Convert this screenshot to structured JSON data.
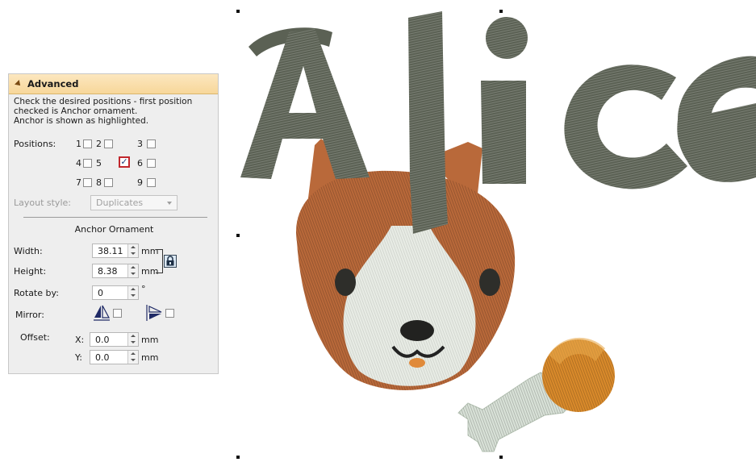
{
  "panel": {
    "header": "Advanced",
    "description": {
      "line1": "Check the desired positions - first position",
      "line2": "checked is Anchor ornament.",
      "line3": "Anchor is shown as highlighted."
    },
    "positions_label": "Positions:",
    "positions": [
      {
        "n": "1",
        "checked": false
      },
      {
        "n": "2",
        "checked": false
      },
      {
        "n": "3",
        "checked": false
      },
      {
        "n": "4",
        "checked": false
      },
      {
        "n": "5",
        "checked": true
      },
      {
        "n": "6",
        "checked": false
      },
      {
        "n": "7",
        "checked": false
      },
      {
        "n": "8",
        "checked": false
      },
      {
        "n": "9",
        "checked": false
      }
    ],
    "layout_style_label": "Layout style:",
    "layout_style_value": "Duplicates",
    "section_title": "Anchor Ornament",
    "width_label": "Width:",
    "width_value": "38.11",
    "height_label": "Height:",
    "height_value": "8.38",
    "rotate_label": "Rotate by:",
    "rotate_value": "0",
    "rotate_unit": "°",
    "mirror_label": "Mirror:",
    "offset_label": "Offset:",
    "x_label": "X:",
    "x_value": "0.0",
    "y_label": "Y:",
    "y_value": "0.0",
    "unit_mm": "mm"
  },
  "canvas": {
    "text": "Alice",
    "colors": {
      "thread_gray": "#5b6154",
      "fur_brown": "#b9693a",
      "fur_white": "#e8ece5",
      "ball_orange": "#d98a2b",
      "bone": "#d9e2d8"
    }
  }
}
